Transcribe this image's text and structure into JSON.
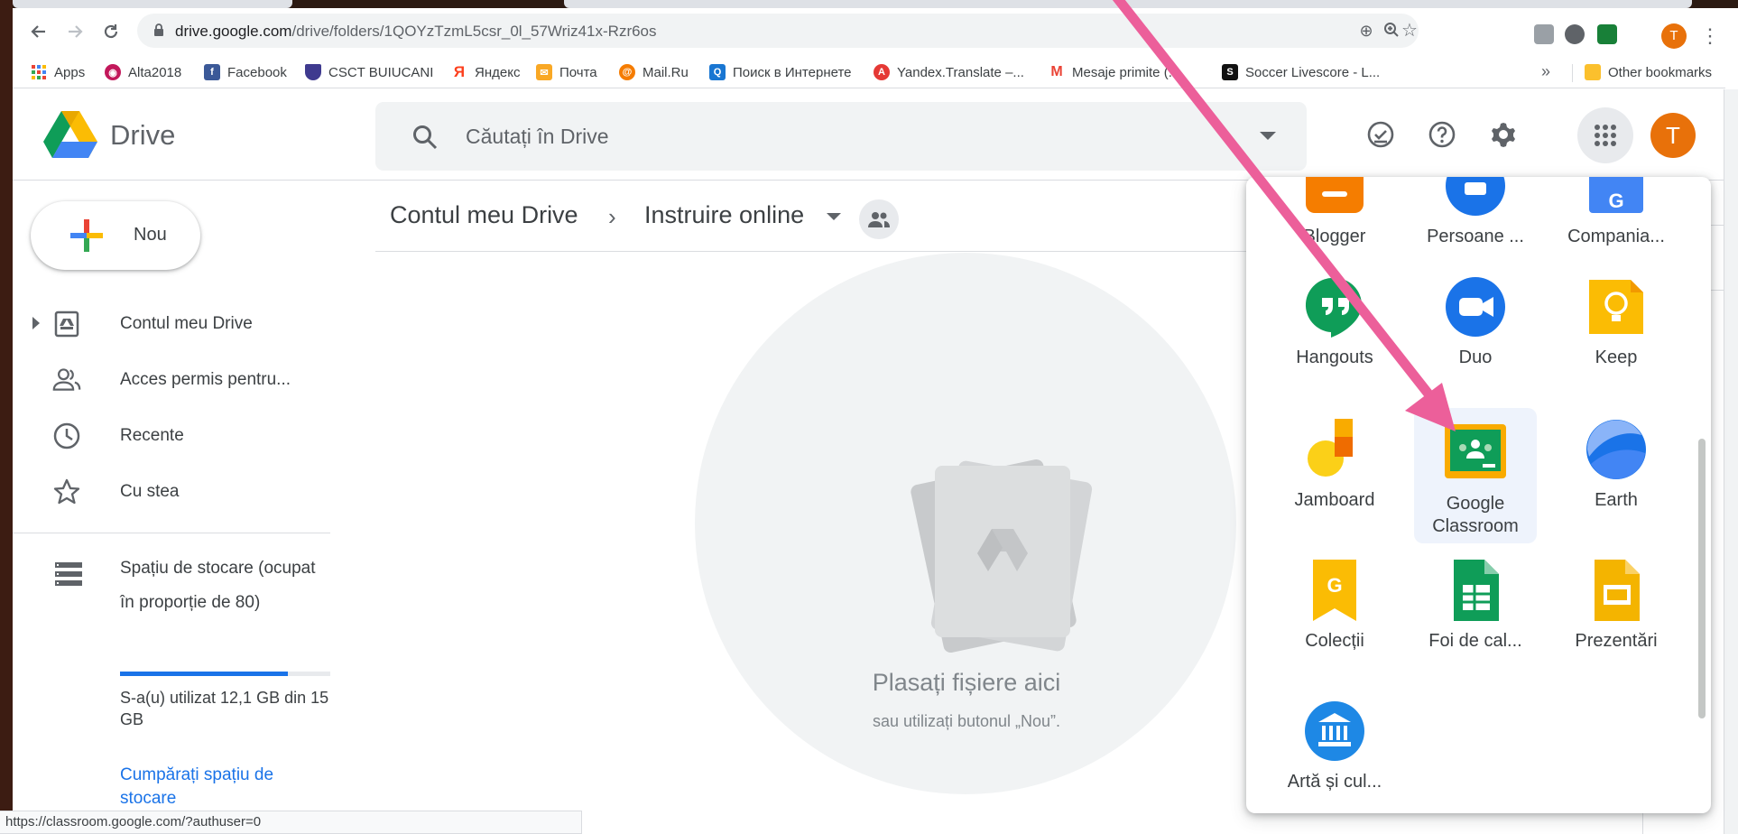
{
  "browser": {
    "url_domain": "drive.google.com",
    "url_path": "/drive/folders/1QOYzTzmL5csr_0l_57Wriz41x-Rzr6os",
    "profile_initial": "T",
    "status_url": "https://classroom.google.com/?authuser=0"
  },
  "bookmarks": {
    "items": [
      {
        "label": "Apps",
        "icon": "apps-grid-icon"
      },
      {
        "label": "Alta2018",
        "icon": "alta-icon"
      },
      {
        "label": "Facebook",
        "icon": "facebook-icon"
      },
      {
        "label": "CSCT BUIUCANI",
        "icon": "shield-icon"
      },
      {
        "label": "Яндекс",
        "icon": "yandex-icon"
      },
      {
        "label": "Почта",
        "icon": "mail-icon"
      },
      {
        "label": "Mail.Ru",
        "icon": "mailru-icon"
      },
      {
        "label": "Поиск в Интернете",
        "icon": "search-icon"
      },
      {
        "label": "Yandex.Translate –...",
        "icon": "translate-icon"
      },
      {
        "label": "Mesaje primite (...",
        "icon": "gmail-icon"
      },
      {
        "label": "Soccer Livescore - L...",
        "icon": "soccer-icon"
      }
    ],
    "overflow": "»",
    "other": "Other bookmarks"
  },
  "drive": {
    "product_name": "Drive",
    "search_placeholder": "Căutați în Drive",
    "avatar_initial": "T"
  },
  "sidebar": {
    "new_label": "Nou",
    "items": [
      {
        "label": "Contul meu Drive",
        "icon": "my-drive-icon"
      },
      {
        "label": "Acces permis pentru...",
        "icon": "shared-people-icon"
      },
      {
        "label": "Recente",
        "icon": "clock-icon"
      },
      {
        "label": "Cu stea",
        "icon": "star-icon"
      }
    ],
    "storage": {
      "title": "Spațiu de stocare (ocupat în proporție de 80)",
      "used_fraction": 0.8,
      "used_text": "S-a(u) utilizat 12,1 GB din 15 GB",
      "buy_label": "Cumpărați spațiu de stocare"
    }
  },
  "content": {
    "breadcrumb_root": "Contul meu Drive",
    "breadcrumb_sep": "›",
    "breadcrumb_current": "Instruire online",
    "drop_title": "Plasați fișiere aici",
    "drop_subtitle": "sau utilizați butonul „Nou”."
  },
  "launcher": {
    "apps": [
      {
        "label": "Blogger",
        "icon": "blogger-icon",
        "color": "#f57d00"
      },
      {
        "label": "Persoane ...",
        "icon": "contacts-icon",
        "color": "#1a73e8"
      },
      {
        "label": "Compania...",
        "icon": "my-business-icon",
        "color": "#4285f4"
      },
      {
        "label": "Hangouts",
        "icon": "hangouts-icon",
        "color": "#0f9d58"
      },
      {
        "label": "Duo",
        "icon": "duo-icon",
        "color": "#1a73e8"
      },
      {
        "label": "Keep",
        "icon": "keep-icon",
        "color": "#fbbc04"
      },
      {
        "label": "Jamboard",
        "icon": "jamboard-icon",
        "color": "#f9ab00"
      },
      {
        "label": "Google Classroom",
        "icon": "classroom-icon",
        "color": "#0f9d58",
        "highlighted": true
      },
      {
        "label": "Earth",
        "icon": "earth-icon",
        "color": "#4285f4"
      },
      {
        "label": "Colecții",
        "icon": "collections-icon",
        "color": "#fbbc04"
      },
      {
        "label": "Foi de cal...",
        "icon": "sheets-icon",
        "color": "#0f9d58"
      },
      {
        "label": "Prezentări",
        "icon": "slides-icon",
        "color": "#f4b400"
      },
      {
        "label": "Artă și cul...",
        "icon": "arts-culture-icon",
        "color": "#1e88e5"
      }
    ]
  },
  "colors": {
    "accent_blue": "#1a73e8",
    "annotation_arrow": "#ec5f9a",
    "avatar_orange": "#e8710a"
  }
}
